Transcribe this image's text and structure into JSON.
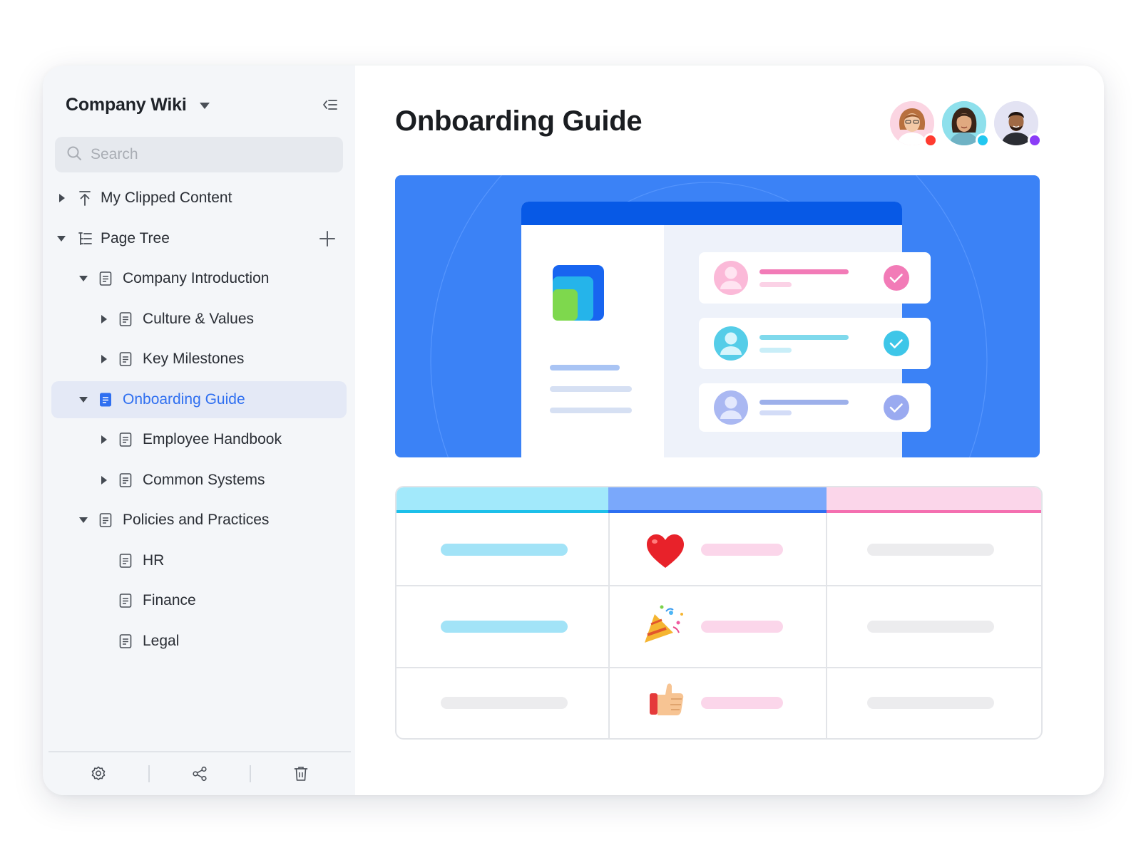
{
  "sidebar": {
    "workspace_title": "Company Wiki",
    "search_placeholder": "Search",
    "tree": [
      {
        "label": "My Clipped Content",
        "icon": "clip-upload-icon"
      },
      {
        "label": "Page Tree",
        "icon": "tree-list-icon"
      },
      {
        "label": "Company Introduction",
        "icon": "document-icon"
      },
      {
        "label": "Culture & Values",
        "icon": "document-icon"
      },
      {
        "label": "Key Milestones",
        "icon": "document-icon"
      },
      {
        "label": "Onboarding Guide",
        "icon": "document-icon",
        "active": true
      },
      {
        "label": "Employee Handbook",
        "icon": "document-icon"
      },
      {
        "label": "Common Systems",
        "icon": "document-icon"
      },
      {
        "label": "Policies and Practices",
        "icon": "document-icon"
      },
      {
        "label": "HR",
        "icon": "document-icon"
      },
      {
        "label": "Finance",
        "icon": "document-icon"
      },
      {
        "label": "Legal",
        "icon": "document-icon"
      }
    ],
    "footer_icons": [
      "settings-icon",
      "share-icon",
      "trash-icon"
    ]
  },
  "main": {
    "page_title": "Onboarding Guide",
    "collaborators": [
      {
        "name": "collaborator-1",
        "status_color": "#ff3b30"
      },
      {
        "name": "collaborator-2",
        "status_color": "#22c7f0"
      },
      {
        "name": "collaborator-3",
        "status_color": "#8b3cf7"
      }
    ],
    "table_emoji": [
      "heart-emoji",
      "party-popper-emoji",
      "thumbs-up-emoji"
    ]
  },
  "colors": {
    "accent": "#2f6ff0",
    "hero_bg": "#3b82f6",
    "sidebar_bg": "#f4f6f9",
    "active_row_bg": "#e4e9f6"
  }
}
